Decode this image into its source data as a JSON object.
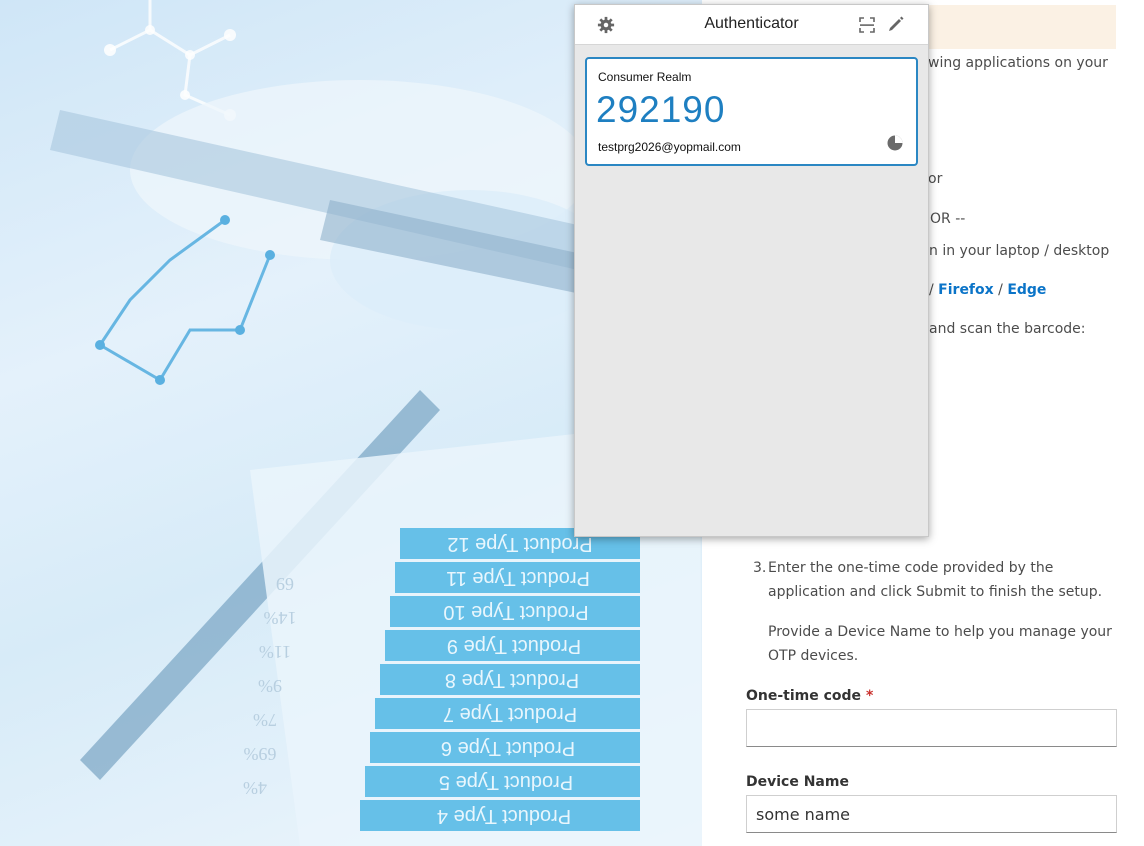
{
  "popup": {
    "title": "Authenticator",
    "icons": [
      "gear-icon",
      "scan-qr-icon",
      "pencil-icon",
      "timer-icon"
    ],
    "entry": {
      "issuer": "Consumer Realm",
      "code": "292190",
      "account": "testprg2026@yopmail.com"
    }
  },
  "page": {
    "lines": [
      "wing applications on your",
      "or",
      "OR --",
      "n in your laptop / desktop",
      "and scan the barcode:"
    ],
    "browsers": {
      "sep1": "/",
      "firefox": "Firefox",
      "sep2": "/",
      "edge": "Edge"
    },
    "step3_number": "3.",
    "step3_text": "Enter the one-time code provided by the application and click Submit to finish the setup.",
    "hint": "Provide a Device Name to help you manage your OTP devices.",
    "otp_label": "One-time code",
    "required_mark": "*",
    "otp_value": "",
    "device_label": "Device Name",
    "device_value": "some name"
  },
  "background": {
    "product_rows": [
      "Product Type 12",
      "Product Type 11",
      "Product Type 10",
      "Product Type 9",
      "Product Type 8",
      "Product Type 7",
      "Product Type 6",
      "Product Type 5",
      "Product Type 4"
    ],
    "percents": [
      "69",
      "14%",
      "11%",
      "9%",
      "7%",
      "69%",
      "4%"
    ]
  },
  "colors": {
    "accent": "#2b87c3",
    "code": "#1e7fc1",
    "link": "#0b74c8",
    "banner": "#fbf1e4",
    "table": "#4fb6e4"
  }
}
